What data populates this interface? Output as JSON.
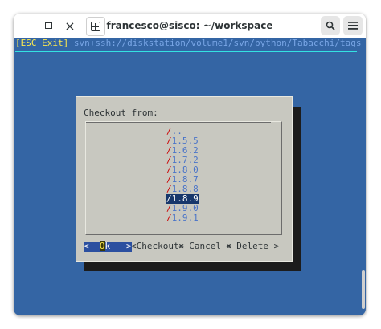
{
  "window": {
    "title": "francesco@sisco: ~/workspace",
    "controls": {
      "minimize": "–",
      "maximize": "▫",
      "close": "×",
      "new_tab": "⊞",
      "search": "🔍",
      "menu": "☰"
    }
  },
  "terminal": {
    "esc_label": "[ESC Exit]",
    "url": "svn+ssh://diskstation/volume1/svn/python/Tabacchi/tags"
  },
  "dialog": {
    "title": "Checkout from:",
    "items": [
      {
        "slash": "/",
        "label": ".."
      },
      {
        "slash": "/",
        "label": "1.5.5"
      },
      {
        "slash": "/",
        "label": "1.6.2"
      },
      {
        "slash": "/",
        "label": "1.7.2"
      },
      {
        "slash": "/",
        "label": "1.8.0"
      },
      {
        "slash": "/",
        "label": "1.8.7"
      },
      {
        "slash": "/",
        "label": "1.8.8"
      },
      {
        "slash": "/",
        "label": "1.8.9"
      },
      {
        "slash": "/",
        "label": "1.9.0"
      },
      {
        "slash": "/",
        "label": "1.9.1"
      }
    ],
    "selected_index": 7,
    "buttons": {
      "ok_left": "<  ",
      "ok_hot": "O",
      "ok_rest": "k   >",
      "checkout": "<Checkout>",
      "cancel": "< Cancel >",
      "delete": "< Delete >"
    }
  },
  "colors": {
    "terminal_bg": "#3465a4",
    "dialog_bg": "#c8c8c0",
    "selection": "#17376b",
    "accent_yellow": "#fce94f"
  }
}
